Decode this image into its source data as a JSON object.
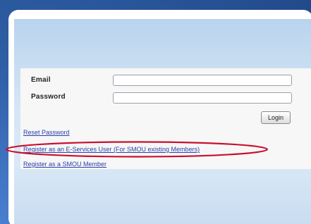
{
  "form": {
    "email_label": "Email",
    "password_label": "Password",
    "email_value": "",
    "password_value": "",
    "login_label": "Login"
  },
  "links": {
    "reset_password": "Reset Password",
    "register_eservices": "Register as an E-Services User (For SMOU existing Members)",
    "register_member": "Register as a SMOU Member"
  },
  "colors": {
    "highlight_ellipse": "#c8102e",
    "link": "#2a3fa8",
    "outer_background": "#2f5fa6"
  }
}
